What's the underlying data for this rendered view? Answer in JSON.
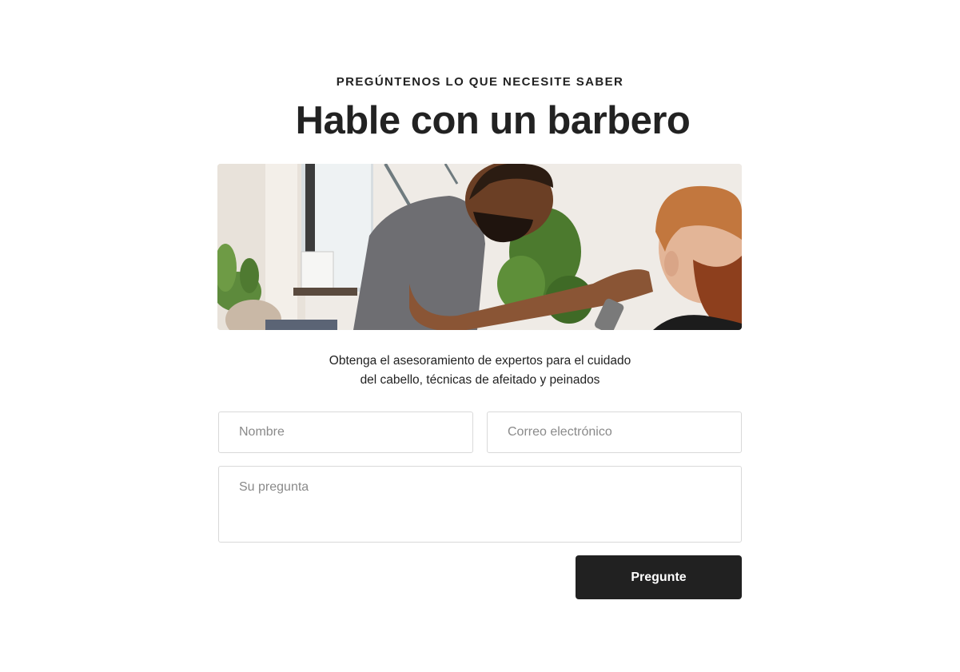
{
  "header": {
    "eyebrow": "PREGÚNTENOS LO QUE NECESITE SABER",
    "title": "Hable con un barbero"
  },
  "hero": {
    "description": "barber-cutting-hair-photo"
  },
  "intro": {
    "line1": "Obtenga el asesoramiento de expertos para el cuidado",
    "line2": "del cabello, técnicas de afeitado y peinados"
  },
  "form": {
    "name_placeholder": "Nombre",
    "email_placeholder": "Correo electrónico",
    "question_placeholder": "Su pregunta",
    "submit_label": "Pregunte"
  },
  "colors": {
    "button_bg": "#212121",
    "text": "#222222",
    "border": "#d9d9d9",
    "placeholder": "#8a8a8a"
  }
}
